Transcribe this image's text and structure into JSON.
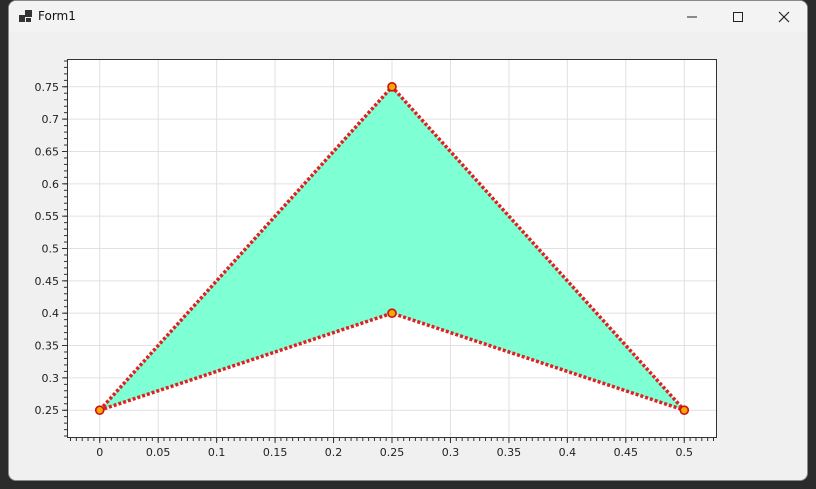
{
  "window": {
    "title": "Form1"
  },
  "icons": {
    "app": "app-window-icon",
    "minimize": "minimize-icon",
    "maximize": "maximize-icon",
    "close": "close-icon"
  },
  "chart_data": {
    "type": "area",
    "title": "",
    "xlabel": "",
    "ylabel": "",
    "grid": true,
    "xlim": [
      -0.028,
      0.528
    ],
    "ylim": [
      0.207,
      0.793
    ],
    "x_ticks": [
      0,
      0.05,
      0.1,
      0.15,
      0.2,
      0.25,
      0.3,
      0.35,
      0.4,
      0.45,
      0.5
    ],
    "x_tick_labels": [
      "0",
      "0.05",
      "0.1",
      "0.15",
      "0.2",
      "0.25",
      "0.3",
      "0.35",
      "0.4",
      "0.45",
      "0.5"
    ],
    "y_ticks": [
      0.25,
      0.3,
      0.35,
      0.4,
      0.45,
      0.5,
      0.55,
      0.6,
      0.65,
      0.7,
      0.75
    ],
    "y_tick_labels": [
      "0.25",
      "0.3",
      "0.35",
      "0.4",
      "0.45",
      "0.5",
      "0.55",
      "0.6",
      "0.65",
      "0.7",
      "0.75"
    ],
    "polygon": [
      {
        "x": 0,
        "y": 0.25
      },
      {
        "x": 0.25,
        "y": 0.75
      },
      {
        "x": 0.5,
        "y": 0.25
      },
      {
        "x": 0.25,
        "y": 0.4
      }
    ],
    "fill_color": "#7fffd4",
    "line_color": "#e02020",
    "marker_fill": "#f5a800",
    "marker_stroke": "#c81414",
    "grid_color": "#e1e1e1"
  }
}
